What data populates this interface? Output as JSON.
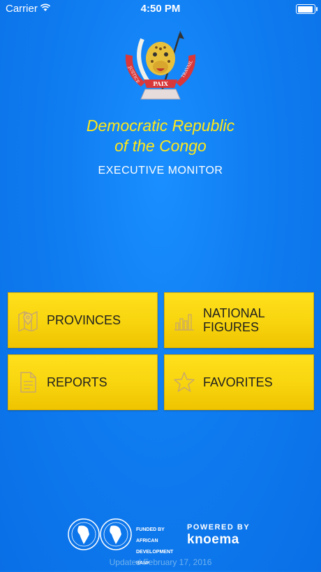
{
  "status_bar": {
    "carrier": "Carrier",
    "time": "4:50 PM"
  },
  "header": {
    "title_line1": "Democratic Republic",
    "title_line2": "of the Congo",
    "subtitle": "EXECUTIVE MONITOR",
    "emblem": {
      "motto_left": "JUSTICE",
      "motto_center": "PAIX",
      "motto_right": "TRAVAIL"
    }
  },
  "tiles": [
    {
      "label": "PROVINCES",
      "icon": "map-pin-icon"
    },
    {
      "label_line1": "NATIONAL",
      "label_line2": "FIGURES",
      "icon": "bar-chart-icon"
    },
    {
      "label": "REPORTS",
      "icon": "document-icon"
    },
    {
      "label": "FAVORITES",
      "icon": "star-icon"
    }
  ],
  "footer": {
    "funded_line1": "FUNDED BY",
    "funded_line2": "AFRICAN",
    "funded_line3": "DEVELOPMENT",
    "funded_line4": "BANK",
    "powered_by": "POWERED BY",
    "brand": "knoema",
    "updated": "Updated February 17, 2016"
  },
  "colors": {
    "background": "#0f7cf0",
    "title": "#ffe81a",
    "tile": "#f7d40e"
  }
}
